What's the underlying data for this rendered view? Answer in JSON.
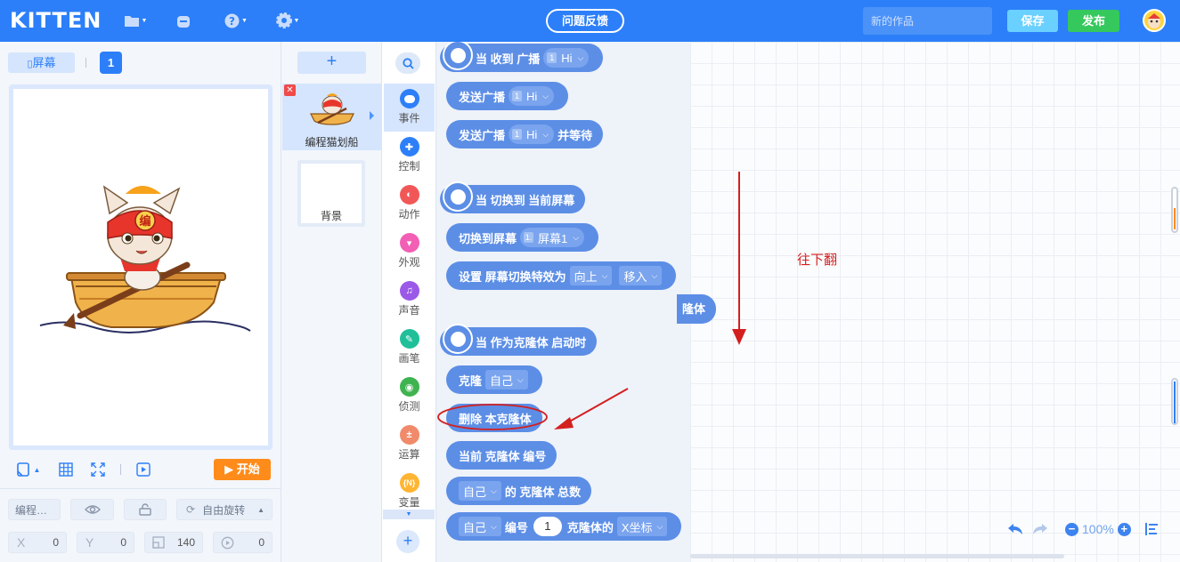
{
  "header": {
    "logo": "KITTEN",
    "feedback_label": "问题反馈",
    "work_name_placeholder": "新的作品",
    "save_label": "保存",
    "publish_label": "发布"
  },
  "stage": {
    "screen_tab_label": "屏幕",
    "screen_number": "1",
    "start_label": "开始"
  },
  "properties": {
    "sprite_name": "编程…",
    "rotation_mode": "自由旋转",
    "x_label": "X",
    "x_value": "0",
    "y_label": "Y",
    "y_value": "0",
    "size_value": "140",
    "direction_value": "0"
  },
  "sprites": {
    "add_label": "+",
    "delete_label": "✕",
    "items": [
      {
        "name": "编程猫划船"
      }
    ],
    "background_label": "背景"
  },
  "categories": [
    {
      "label": "事件",
      "color": "#2c7ff8",
      "active": true
    },
    {
      "label": "控制",
      "color": "#2c7ff8"
    },
    {
      "label": "动作",
      "color": "#f25757"
    },
    {
      "label": "外观",
      "color": "#f25fb5"
    },
    {
      "label": "声音",
      "color": "#9b59e8"
    },
    {
      "label": "画笔",
      "color": "#1fbf9a"
    },
    {
      "label": "侦测",
      "color": "#3fb34f"
    },
    {
      "label": "运算",
      "color": "#f08a6a"
    },
    {
      "label": "变量",
      "color": "#ffb533",
      "icon_text": "{N}"
    }
  ],
  "categories_add_label": "+",
  "blocks": {
    "when_receive": {
      "text": "当 收到 广播",
      "pill_num": "1",
      "pill_value": "Hi"
    },
    "send_broadcast": {
      "text": "发送广播",
      "pill_num": "1",
      "pill_value": "Hi"
    },
    "send_wait": {
      "text": "发送广播",
      "pill_num": "1",
      "pill_value": "Hi",
      "suffix": "并等待"
    },
    "when_switch": {
      "text": "当 切换到 当前屏幕"
    },
    "switch_screen": {
      "text": "切换到屏幕",
      "pill_num": "1.",
      "pill_value": "屏幕1"
    },
    "screen_effect": {
      "text": "设置 屏幕切换特效为",
      "dir_value": "向上",
      "mode_value": "移入"
    },
    "when_clone": {
      "text": "当 作为克隆体 启动时"
    },
    "clone": {
      "text": "克隆",
      "target_value": "自己"
    },
    "delete_clone": {
      "text": "删除 本克隆体"
    },
    "clone_index": {
      "text": "当前 克隆体 编号"
    },
    "clone_count": {
      "target_value": "自己",
      "text": "的 克隆体 总数"
    },
    "clone_prop": {
      "target_value": "自己",
      "label1": "编号",
      "index_value": "1",
      "label2": "克隆体的",
      "prop_value": "X坐标"
    }
  },
  "canvas": {
    "stray_block_text": "隆体",
    "annotation_text": "往下翻",
    "zoom_label": "100%"
  },
  "colors": {
    "primary": "#2c7ff8",
    "block": "#5c8ee6",
    "annotation": "#d41f1f"
  }
}
